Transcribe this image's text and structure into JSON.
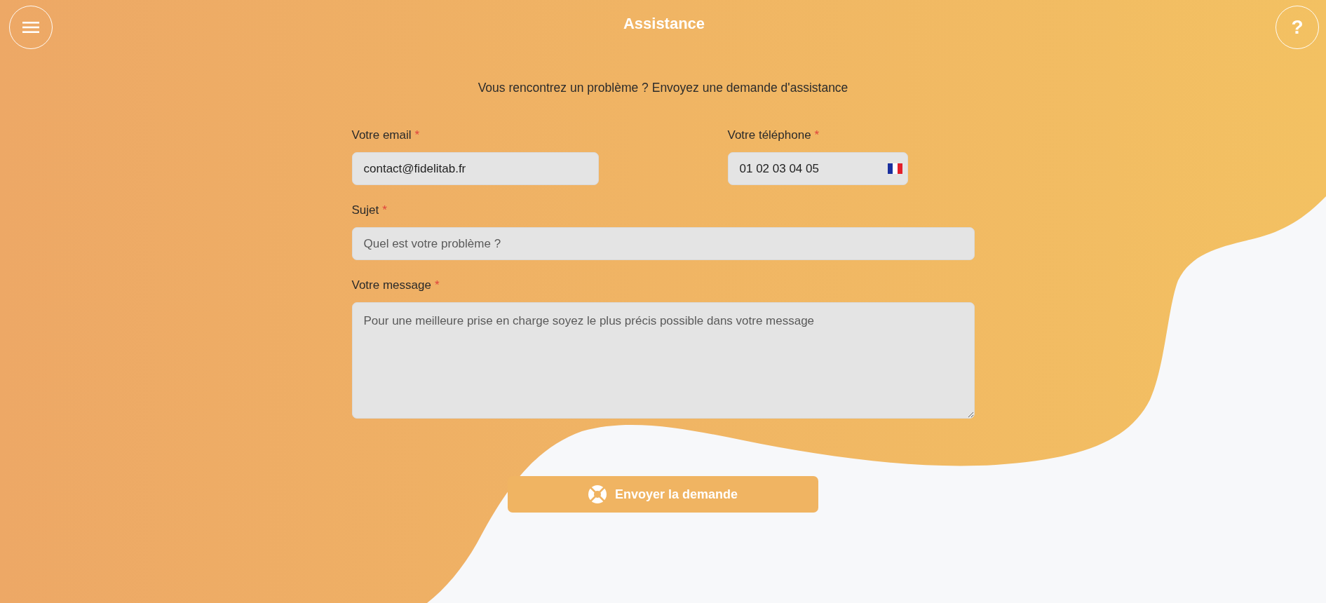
{
  "header": {
    "title": "Assistance",
    "help_button": "?"
  },
  "intro": "Vous rencontrez un problème ? Envoyez une demande d'assistance",
  "form": {
    "rows": [
      [
        {
          "kind": "email",
          "label": "Votre email",
          "required_mark": "*",
          "value": "contact@fidelitab.fr"
        },
        {
          "kind": "phone",
          "label": "Votre téléphone",
          "required_mark": "*",
          "value": "01 02 03 04 05"
        }
      ],
      [
        {
          "kind": "text",
          "label": "Sujet",
          "required_mark": "*",
          "placeholder": "Quel est votre problème ?"
        }
      ],
      [
        {
          "kind": "textarea",
          "label": "Votre message",
          "required_mark": "*",
          "placeholder": "Pour une meilleure prise en charge soyez le plus précis possible dans votre message"
        }
      ]
    ]
  },
  "submit_button": {
    "label": "Envoyer la demande"
  }
}
